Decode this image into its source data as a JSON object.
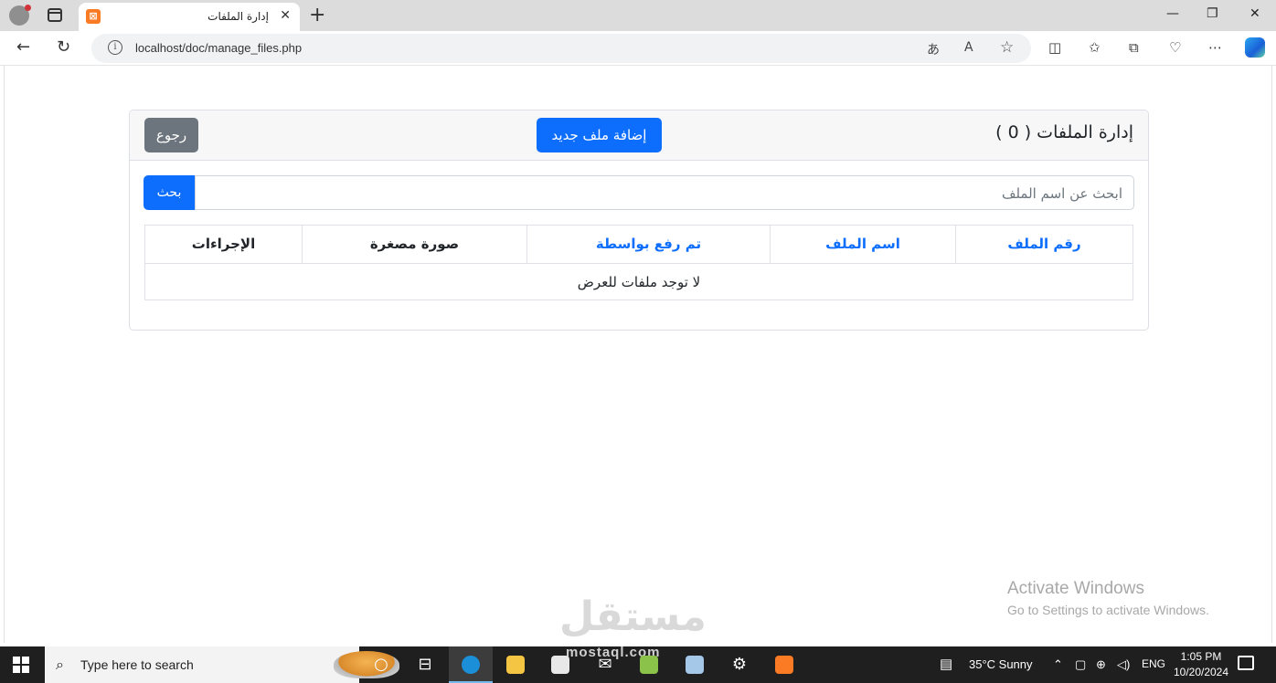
{
  "browser": {
    "tab_title": "إدارة الملفات",
    "tab_close": "✕",
    "new_tab": "+",
    "url": "localhost/doc/manage_files.php",
    "window_controls": [
      "—",
      "❐",
      "✕"
    ],
    "icons": [
      "back-icon",
      "refresh-icon",
      "info-icon",
      "read-aloud-icon",
      "favorite-icon",
      "split-screen-icon",
      "favorites-icon",
      "collections-icon",
      "performance-icon",
      "more-icon",
      "copilot-icon"
    ]
  },
  "page": {
    "title": "إدارة الملفات ( 0 )",
    "add_button": "إضافة ملف جديد",
    "back_button": "رجوع",
    "search_placeholder": "ابحث عن اسم الملف",
    "search_button": "بحث",
    "table": {
      "headers": [
        {
          "label": "رقم الملف",
          "sortable": true
        },
        {
          "label": "اسم الملف",
          "sortable": true
        },
        {
          "label": "تم رفع بواسطة",
          "sortable": true
        },
        {
          "label": "صورة مصغرة",
          "sortable": false
        },
        {
          "label": "الإجراءات",
          "sortable": false
        }
      ],
      "empty_message": "لا توجد ملفات للعرض"
    }
  },
  "watermarks": {
    "activate_line1": "Activate Windows",
    "activate_line2": "Go to Settings to activate Windows.",
    "logo": "مستقل",
    "logo_sub": "mostaql.com"
  },
  "taskbar": {
    "search_placeholder": "Type here to search",
    "weather": "35°C  Sunny",
    "language": "ENG",
    "time": "1:05 PM",
    "date": "10/20/2024"
  },
  "colors": {
    "primary": "#0d6efd",
    "secondary": "#6c757d",
    "xampp": "#fb7a24"
  }
}
